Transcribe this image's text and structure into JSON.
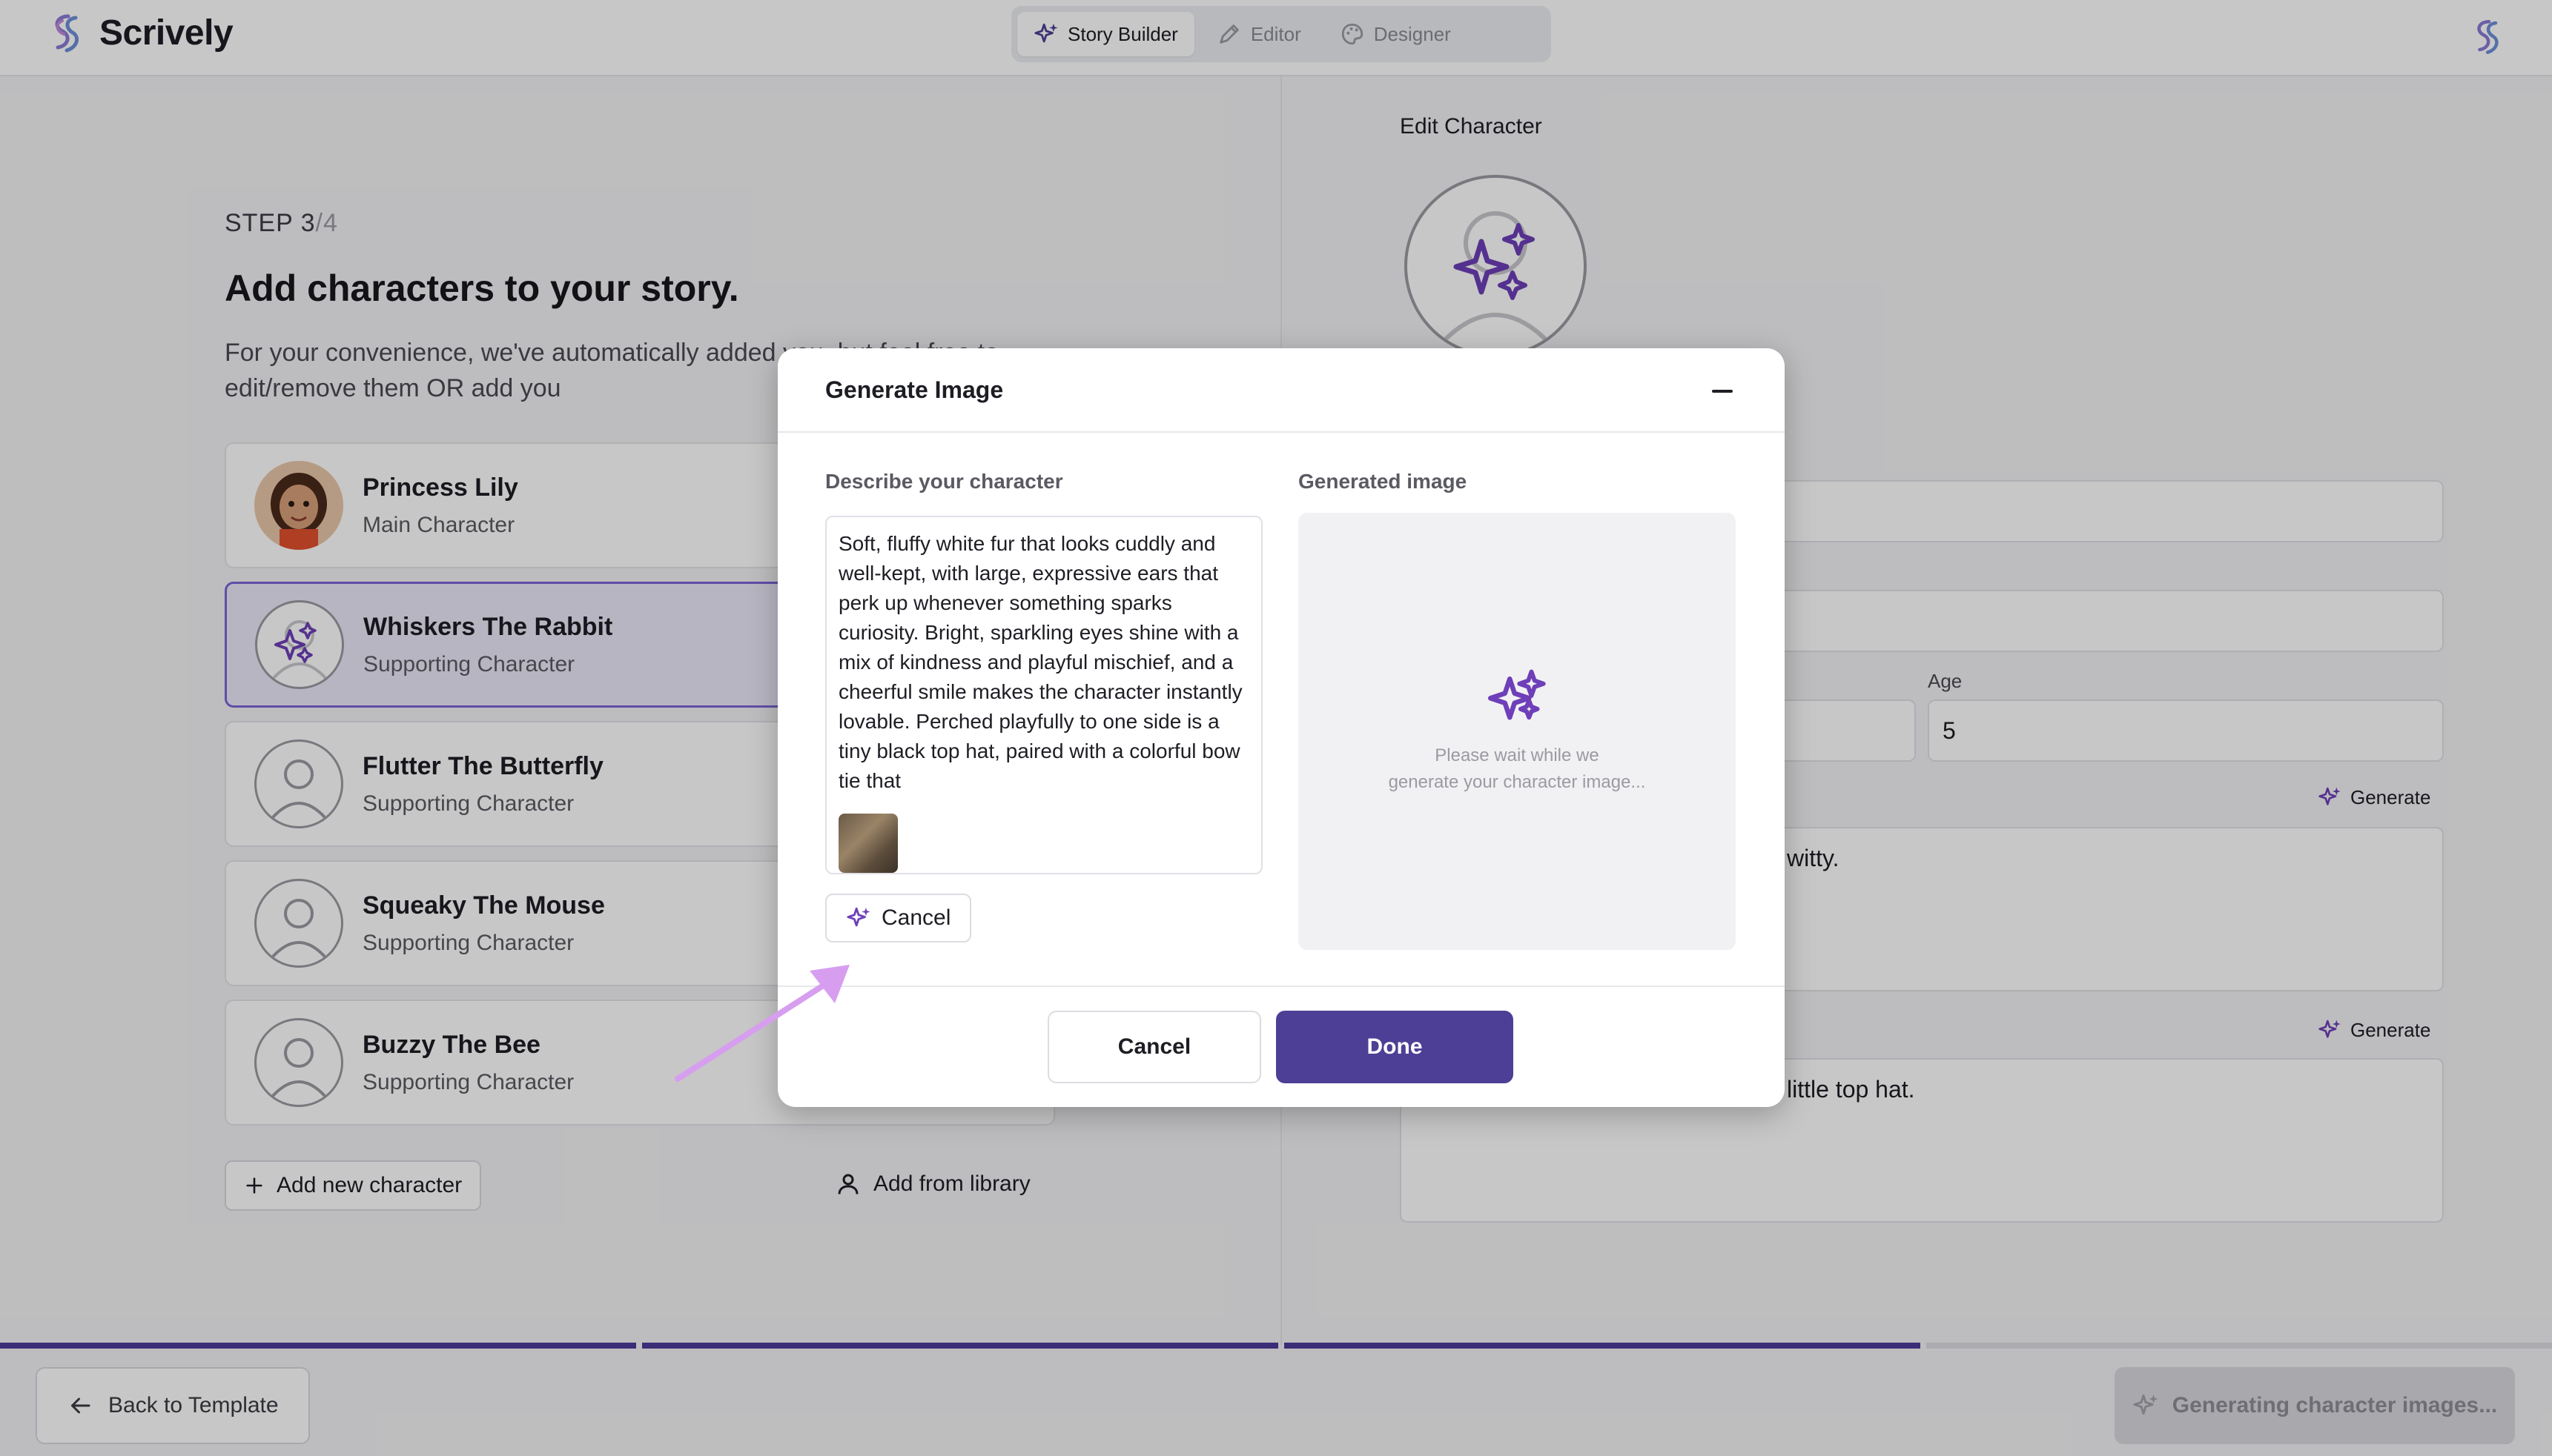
{
  "app": {
    "name": "Scrively",
    "tabs": [
      {
        "label": "Story Builder",
        "icon": "sparkles-icon",
        "active": true
      },
      {
        "label": "Editor",
        "icon": "pen-icon",
        "active": false
      },
      {
        "label": "Designer",
        "icon": "palette-icon",
        "active": false
      }
    ]
  },
  "builder": {
    "step_label": "STEP 3",
    "step_total": "/4",
    "heading": "Add characters to your story.",
    "description": "For your convenience, we've automatically added some characters for you, but feel free to edit/remove them OR add your own!",
    "description_visible": "For your convenience, we've automatically added  you, but feel free to edit/remove them OR add you",
    "characters": [
      {
        "name": "Princess Lily",
        "role": "Main Character",
        "selected": false
      },
      {
        "name": "Whiskers The Rabbit",
        "role": "Supporting Character",
        "selected": true
      },
      {
        "name": "Flutter The Butterfly",
        "role": "Supporting Character",
        "selected": false
      },
      {
        "name": "Squeaky The Mouse",
        "role": "Supporting Character",
        "selected": false
      },
      {
        "name": "Buzzy The Bee",
        "role": "Supporting Character",
        "selected": false
      }
    ],
    "add_new_label": "Add new character",
    "add_library_label": "Add from library"
  },
  "edit": {
    "title": "Edit Character",
    "age_label": "Age",
    "age_value": "5",
    "generate_label": "Generate",
    "personality_partial": "witty.",
    "appearance_partial": "little top hat."
  },
  "modal": {
    "title": "Generate Image",
    "describe_label": "Describe your character",
    "description_text": "Soft, fluffy white fur that looks cuddly and well-kept, with large, expressive ears that perk up whenever something sparks curiosity. Bright, sparkling eyes shine with a mix of kindness and playful mischief, and a cheerful smile makes the character instantly lovable. Perched playfully to one side is a tiny black top hat, paired with a colorful bow tie that",
    "inline_cancel_label": "Cancel",
    "generated_label": "Generated image",
    "wait_line1": "Please wait while we",
    "wait_line2": "generate your character image...",
    "cancel_label": "Cancel",
    "done_label": "Done"
  },
  "footer": {
    "back_label": "Back to Template",
    "status_label": "Generating character images...",
    "progress_segments_done": 3,
    "progress_segments_total": 4
  },
  "colors": {
    "accent": "#4d3f95",
    "accent_icon": "#6e3fb8",
    "selected_bg": "#ece8f9",
    "selected_border": "#7b63d6"
  }
}
